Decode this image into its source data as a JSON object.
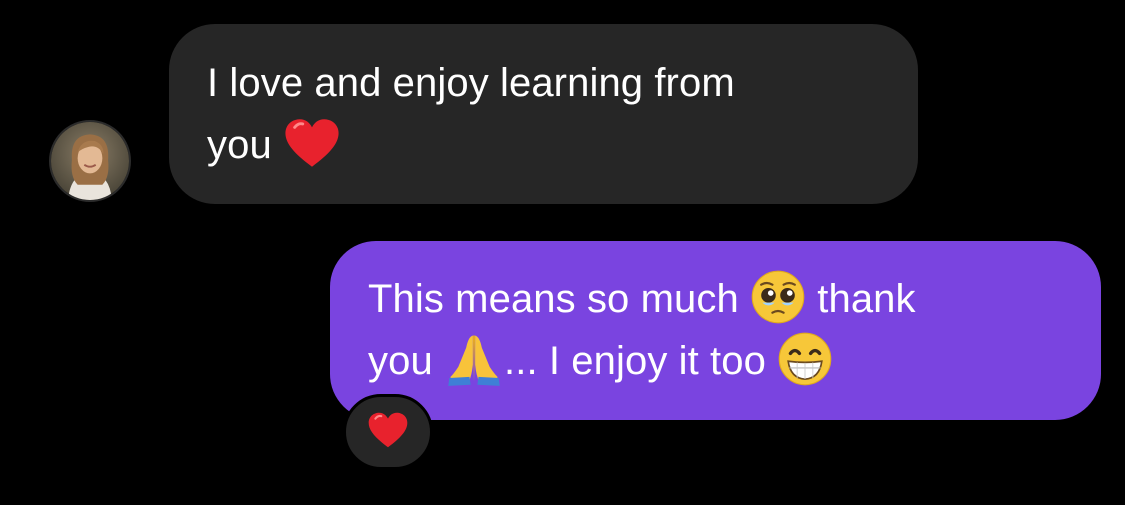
{
  "thread": {
    "messages": [
      {
        "direction": "incoming",
        "lines": [
          "I love and enjoy learning from",
          "you"
        ],
        "emojis": [
          "red-heart-emoji"
        ]
      },
      {
        "direction": "outgoing",
        "line1_a": "This means so much",
        "line1_b": "thank",
        "line2_a": "you",
        "line2_b": "... I enjoy it too",
        "emojis": [
          "pleading-face-emoji",
          "folded-hands-emoji",
          "grinning-face-emoji"
        ],
        "reaction": "red-heart-emoji"
      }
    ]
  },
  "colors": {
    "background": "#000000",
    "incoming_bubble": "#262626",
    "outgoing_bubble": "#7a44e0",
    "text": "#ffffff",
    "heart": "#e8222d"
  }
}
